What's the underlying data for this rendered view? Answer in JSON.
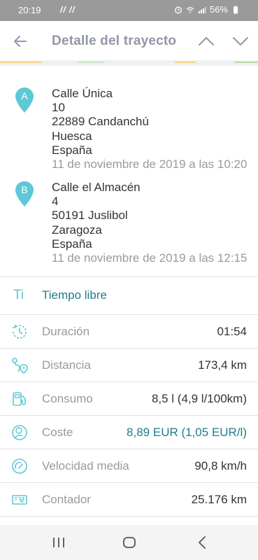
{
  "status_bar": {
    "time": "20:19",
    "notifications": "// //",
    "battery": "56%"
  },
  "header": {
    "title": "Detalle del trayecto"
  },
  "route": {
    "start": {
      "marker": "A",
      "street": "Calle Única",
      "number": "10",
      "postal_city": "22889 Candanchú",
      "province": "Huesca",
      "country": "España",
      "timestamp": "11 de noviembre de 2019 a las 10:20"
    },
    "end": {
      "marker": "B",
      "street": "Calle el Almacén",
      "number": "4",
      "postal_city": "50191 Juslibol",
      "province": "Zaragoza",
      "country": "España",
      "timestamp": "11 de noviembre de 2019 a las 12:15"
    }
  },
  "details": {
    "trip_type": {
      "icon_text": "Ti",
      "label": "Tiempo libre"
    },
    "duration": {
      "label": "Duración",
      "value": "01:54"
    },
    "distance": {
      "label": "Distancia",
      "value": "173,4 km"
    },
    "consumption": {
      "label": "Consumo",
      "value": "8,5 l (4,9 l/100km)"
    },
    "cost": {
      "label": "Coste",
      "value": "8,89 EUR (1,05 EUR/l)"
    },
    "avg_speed": {
      "label": "Velocidad media",
      "value": "90,8 km/h"
    },
    "odometer": {
      "label": "Contador",
      "value": "25.176 km"
    }
  },
  "colors": {
    "accent": "#5ec8d6",
    "accent_dark": "#1e7d8c",
    "header_text": "#9296a8",
    "label_gray": "#999999"
  },
  "icons": {
    "back": "arrow-left-icon",
    "previous": "chevron-up-icon",
    "next": "chevron-down-icon",
    "duration": "clock-rotate-icon",
    "distance": "route-pin-icon",
    "consumption": "fuel-pump-icon",
    "cost": "coin-leaf-icon",
    "avg_speed": "speedometer-icon",
    "odometer": "odometer-icon"
  }
}
